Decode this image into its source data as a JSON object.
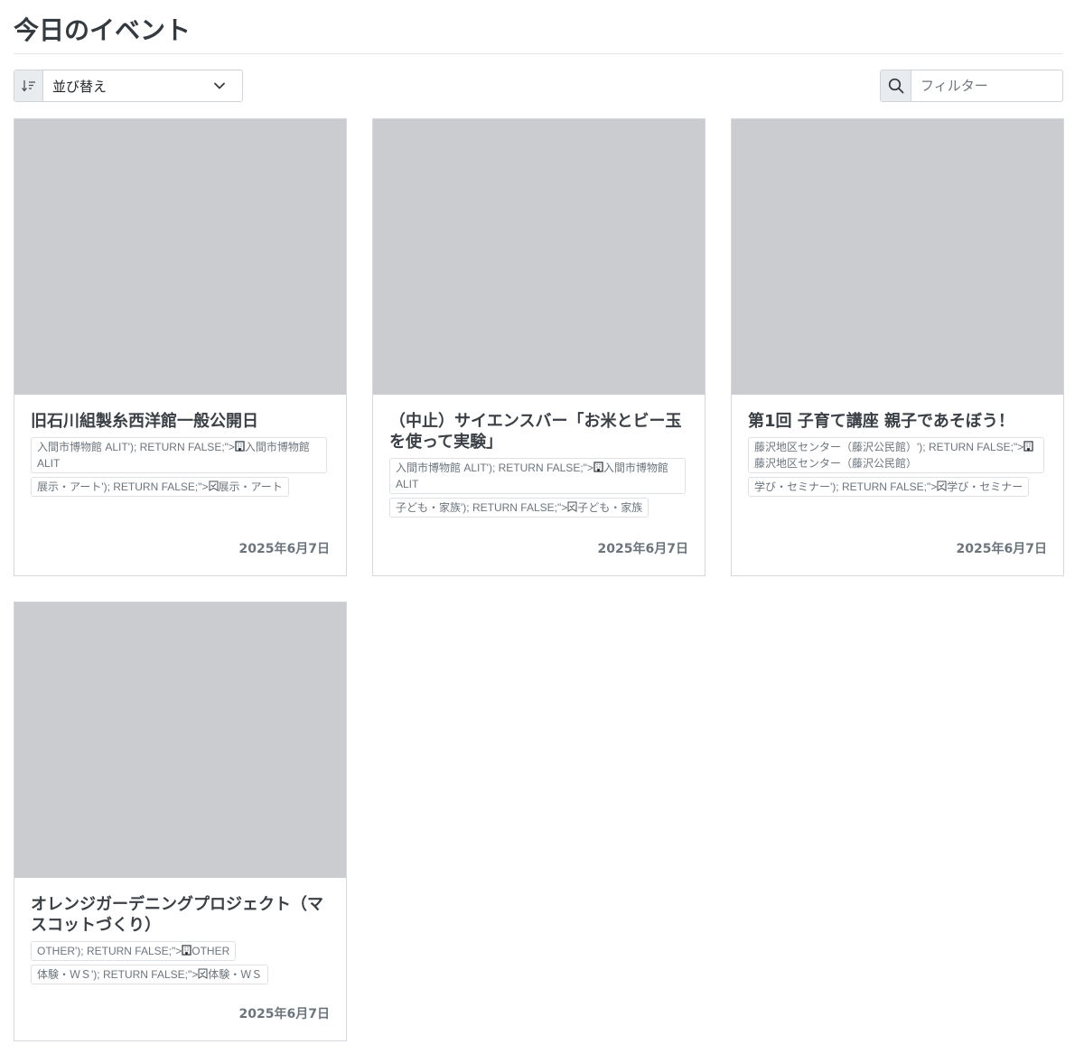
{
  "page": {
    "title": "今日のイベント"
  },
  "sort": {
    "label": "並び替え"
  },
  "filter": {
    "placeholder": "フィルター"
  },
  "cards": [
    {
      "title": "旧石川組製糸西洋館一般公開日",
      "venue_prefix": "入間市博物館 ALIT'); RETURN FALSE;\">",
      "venue": "入間市博物館 ALIT",
      "category_prefix": "展示・アート'); RETURN FALSE;\">",
      "category": "展示・アート",
      "date": "2025年6月7日"
    },
    {
      "title": "（中止）サイエンスバー「お米とビー玉を使って実験」",
      "venue_prefix": "入間市博物館 ALIT'); RETURN FALSE;\">",
      "venue": "入間市博物館 ALIT",
      "category_prefix": "子ども・家族'); RETURN FALSE;\">",
      "category": "子ども・家族",
      "date": "2025年6月7日"
    },
    {
      "title": "第1回 子育て講座 親子であそぼう！",
      "venue_prefix": "藤沢地区センター（藤沢公民館）'); RETURN FALSE;\">",
      "venue": "藤沢地区センター（藤沢公民館）",
      "category_prefix": "学び・セミナー'); RETURN FALSE;\">",
      "category": "学び・セミナー",
      "date": "2025年6月7日"
    },
    {
      "title": "オレンジガーデニングプロジェクト（マスコットづくり）",
      "venue_prefix": "OTHER'); RETURN FALSE;\">",
      "venue": "OTHER",
      "category_prefix": "体験・ＷＳ'); RETURN FALSE;\">",
      "category": "体験・ＷＳ",
      "date": "2025年6月7日"
    }
  ],
  "icons": {
    "sort": "sort-down-icon",
    "chevron": "chevron-down-icon",
    "search": "search-icon",
    "venue": "building-icon",
    "category": "tag-check-icon"
  }
}
